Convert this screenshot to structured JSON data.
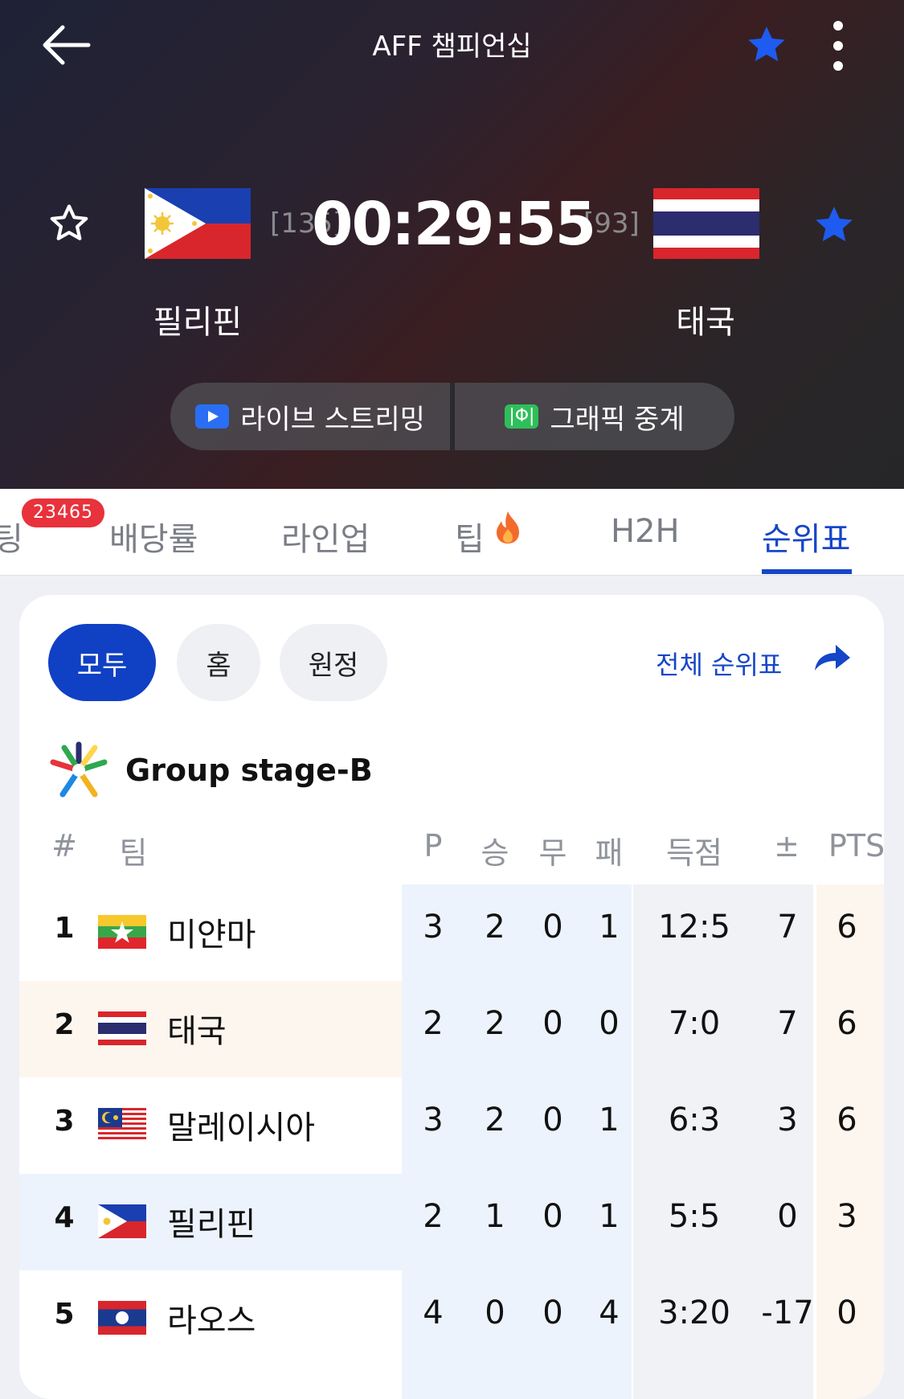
{
  "header": {
    "title": "AFF 챔피언십",
    "home": {
      "name": "필리핀",
      "odds": "[135]"
    },
    "away": {
      "name": "태국",
      "odds": "[93]"
    },
    "clock": "00:29:55",
    "watch": {
      "live": "라이브 스트리밍",
      "graphic": "그래픽 중계",
      "graphic_glyph": "|Φ|"
    }
  },
  "colors": {
    "accent": "#1646c8",
    "badge": "#e8323c",
    "fav_active": "#1e5bf0"
  },
  "tabs": {
    "partial": "팅",
    "badge": "23465",
    "items": [
      "배당률",
      "라인업",
      "팁",
      "H2H",
      "순위표"
    ],
    "active": "순위표"
  },
  "standings": {
    "filters": [
      "모두",
      "홈",
      "원정"
    ],
    "full_table": "전체 순위표",
    "group": "Group stage-B",
    "columns": {
      "rank": "#",
      "team": "팀",
      "p": "P",
      "w": "승",
      "d": "무",
      "l": "패",
      "goals": "득점",
      "diff": "±",
      "pts": "PTS"
    },
    "rows": [
      {
        "rank": "1",
        "team": "미얀마",
        "flag": "myanmar-flag",
        "p": "3",
        "w": "2",
        "d": "0",
        "l": "1",
        "goals": "12:5",
        "diff": "7",
        "pts": "6"
      },
      {
        "rank": "2",
        "team": "태국",
        "flag": "thailand-flag",
        "p": "2",
        "w": "2",
        "d": "0",
        "l": "0",
        "goals": "7:0",
        "diff": "7",
        "pts": "6"
      },
      {
        "rank": "3",
        "team": "말레이시아",
        "flag": "malaysia-flag",
        "p": "3",
        "w": "2",
        "d": "0",
        "l": "1",
        "goals": "6:3",
        "diff": "3",
        "pts": "6"
      },
      {
        "rank": "4",
        "team": "필리핀",
        "flag": "philippines-flag",
        "p": "2",
        "w": "1",
        "d": "0",
        "l": "1",
        "goals": "5:5",
        "diff": "0",
        "pts": "3"
      },
      {
        "rank": "5",
        "team": "라오스",
        "flag": "laos-flag",
        "p": "4",
        "w": "0",
        "d": "0",
        "l": "4",
        "goals": "3:20",
        "diff": "-17",
        "pts": "0"
      }
    ]
  }
}
